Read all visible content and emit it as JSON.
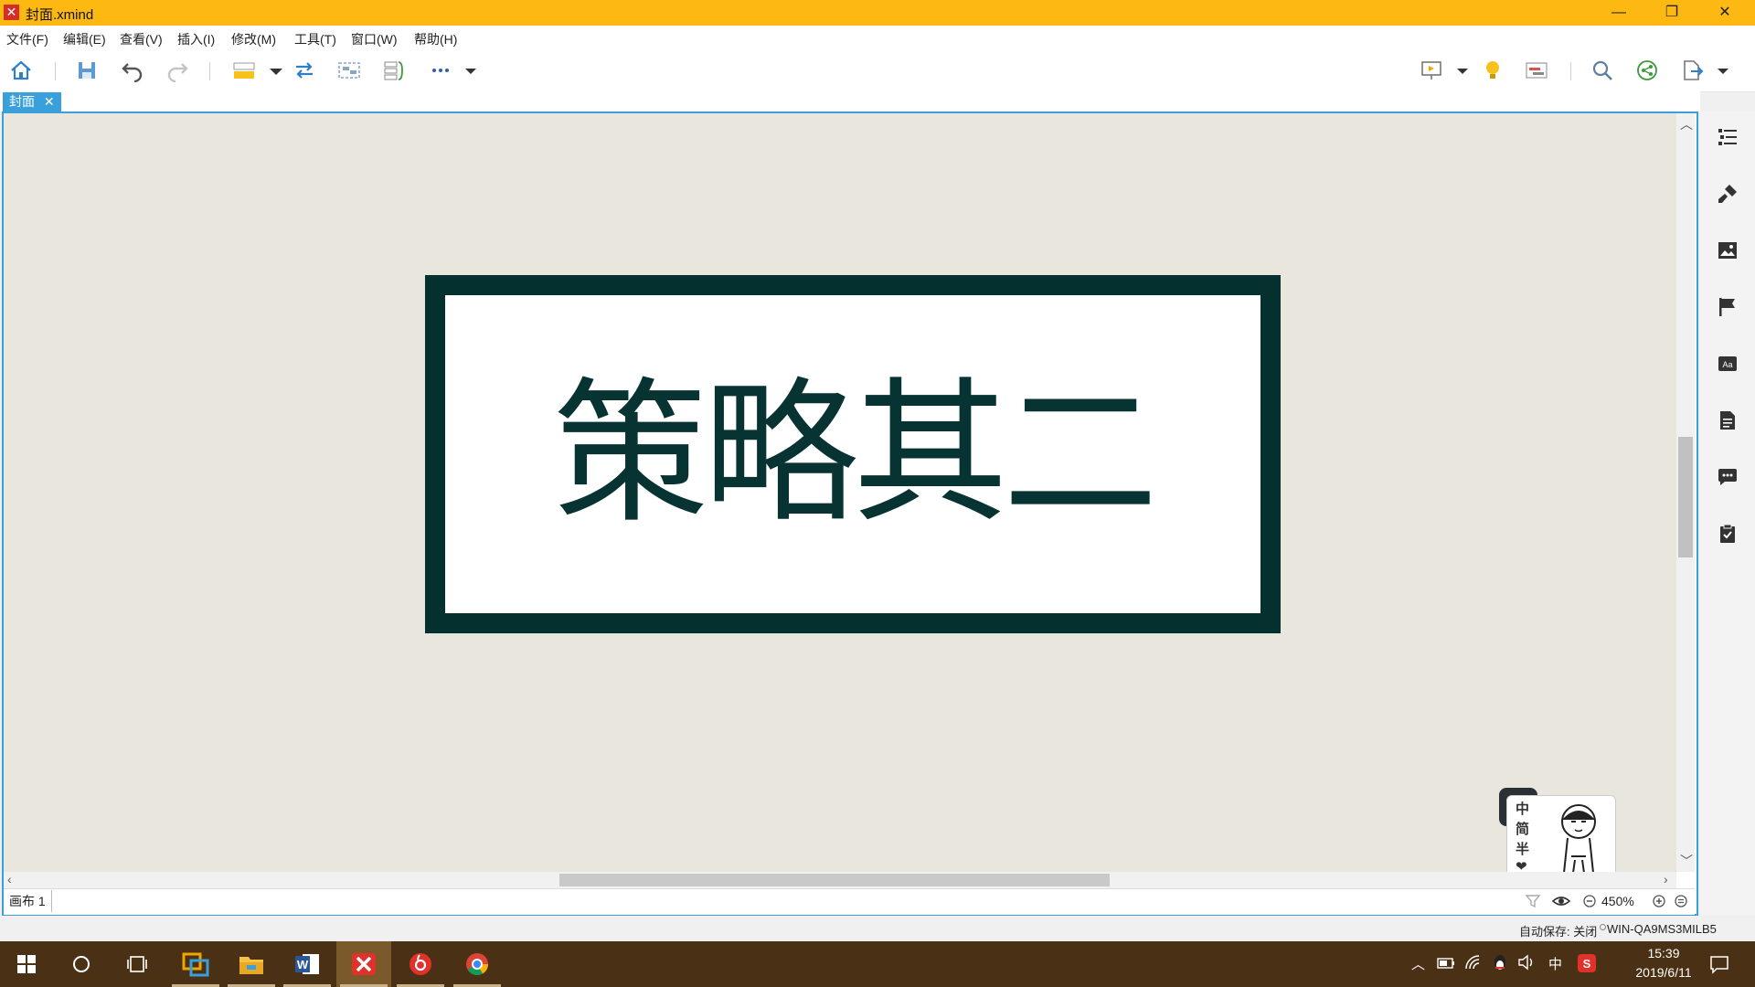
{
  "window": {
    "title": "封面.xmind",
    "app_icon": "xmind-icon",
    "controls": [
      "—",
      "❐",
      "✕"
    ]
  },
  "menu": [
    "文件(F)",
    "编辑(E)",
    "查看(V)",
    "插入(I)",
    "修改(M)",
    "工具(T)",
    "窗口(W)",
    "帮助(H)"
  ],
  "toolbar": {
    "left": [
      "home-icon",
      "save-icon",
      "undo-icon",
      "redo-icon",
      "topic-icon",
      "relationship-icon",
      "boundary-icon",
      "summary-icon",
      "more-icon"
    ],
    "right": [
      "presentation-icon",
      "idea-icon",
      "gantt-icon",
      "search-icon",
      "share-icon",
      "export-icon"
    ]
  },
  "tabs": [
    {
      "label": "封面",
      "close": "✕",
      "active": true
    }
  ],
  "canvas": {
    "background": "#e9e7dd",
    "central_topic": "策略其二",
    "topic_border": "#053030"
  },
  "sheet_tab": "画布 1",
  "zoom": "450%",
  "status": {
    "autosave": "自动保存: 关闭",
    "host": "WIN-QA9MS3MILB5"
  },
  "ime_widget": {
    "chars": [
      "中",
      "简",
      "半",
      "❤"
    ]
  },
  "taskbar": {
    "apps": [
      "start-icon",
      "search-circle-icon",
      "task-view-icon",
      "remote-desktop-icon",
      "file-explorer-icon",
      "word-icon",
      "xmind-icon",
      "netease-music-icon",
      "chrome-icon"
    ],
    "tray_ime": "中",
    "time": "15:39",
    "date": "2019/6/11"
  }
}
